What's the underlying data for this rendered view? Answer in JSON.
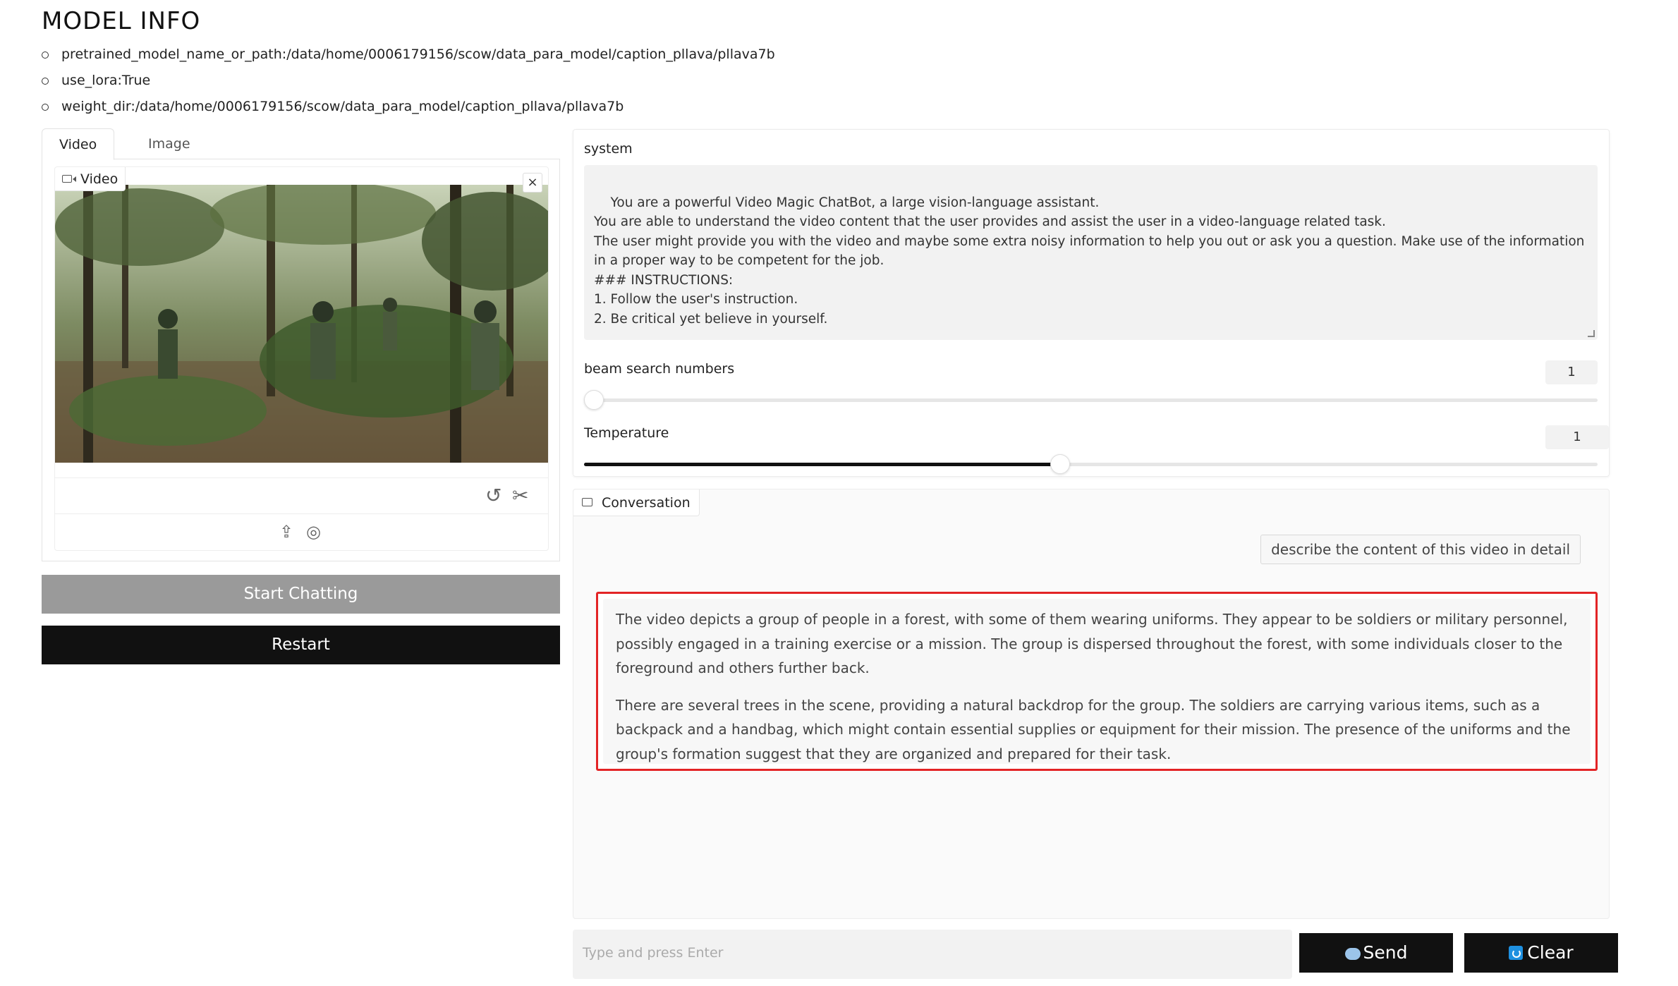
{
  "model_info": {
    "title": "MODEL INFO",
    "items": [
      "pretrained_model_name_or_path:/data/home/0006179156/scow/data_para_model/caption_pllava/pllava7b",
      "use_lora:True",
      "weight_dir:/data/home/0006179156/scow/data_para_model/caption_pllava/pllava7b"
    ]
  },
  "tabs": [
    {
      "label": "Video",
      "active": true
    },
    {
      "label": "Image",
      "active": false
    }
  ],
  "video": {
    "label": "Video",
    "close_icon": "×",
    "icons": [
      "camera-icon",
      "close-icon",
      "undo-icon",
      "scissors-icon",
      "upload-icon",
      "webcam-icon"
    ]
  },
  "buttons": {
    "start": "Start Chatting",
    "restart": "Restart",
    "send": "Send",
    "clear": "Clear"
  },
  "settings": {
    "system_label": "system",
    "system_text": "You are a powerful Video Magic ChatBot, a large vision-language assistant.\nYou are able to understand the video content that the user provides and assist the user in a video-language related task.\nThe user might provide you with the video and maybe some extra noisy information to help you out or ask you a question. Make use of the information in a proper way to be competent for the job.\n### INSTRUCTIONS:\n1. Follow the user's instruction.\n2. Be critical yet believe in yourself.",
    "beam_label": "beam search numbers",
    "beam_value": "1",
    "beam_level": 0.0,
    "temperature_label": "Temperature",
    "temperature_value": "1",
    "temperature_level": 0.47
  },
  "conversation": {
    "label": "Conversation",
    "user_message": "describe the content of this video in detail",
    "bot_paragraphs": [
      "The video depicts a group of people in a forest, with some of them wearing uniforms. They appear to be soldiers or military personnel, possibly engaged in a training exercise or a mission. The group is dispersed throughout the forest, with some individuals closer to the foreground and others further back.",
      "There are several trees in the scene, providing a natural backdrop for the group. The soldiers are carrying various items, such as a backpack and a handbag, which might contain essential supplies or equipment for their mission. The presence of the uniforms and the group's formation suggest that they are organized and prepared for their task."
    ],
    "highlight_color": "#e32426"
  },
  "input": {
    "placeholder": "Type and press Enter"
  },
  "colors": {
    "dark_button": "#111111",
    "disabled_button": "#9a9a9a",
    "clear_icon": "#1e90e0"
  }
}
